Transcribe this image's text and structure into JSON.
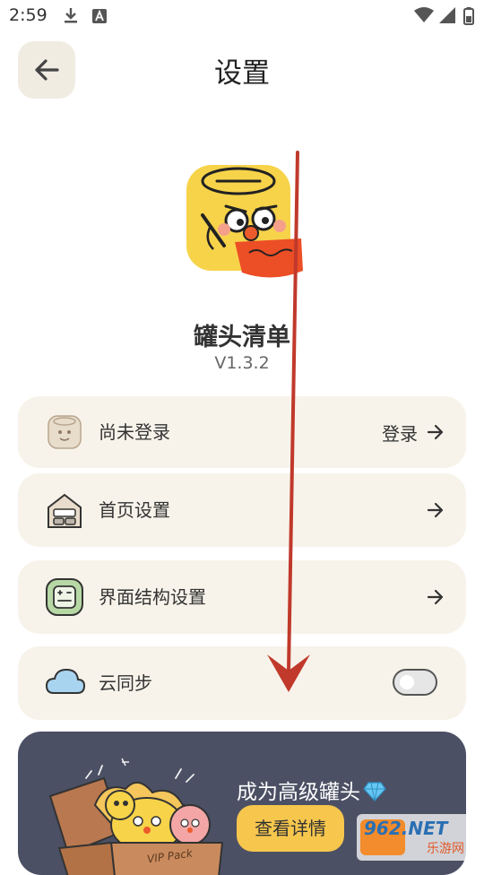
{
  "status_bar": {
    "time": "2:59"
  },
  "header": {
    "title": "设置"
  },
  "app": {
    "name": "罐头清单",
    "version": "V1.3.2"
  },
  "menu": {
    "login": {
      "label": "尚未登录",
      "action": "登录"
    },
    "home_settings": {
      "label": "首页设置"
    },
    "layout_settings": {
      "label": "界面结构设置"
    },
    "cloud_sync": {
      "label": "云同步",
      "enabled": false
    }
  },
  "promo": {
    "title": "成为高级罐头",
    "button": "查看详情",
    "badge": "VIP Pack"
  },
  "watermark": {
    "text1": "962.NET",
    "text2": "乐游网"
  }
}
